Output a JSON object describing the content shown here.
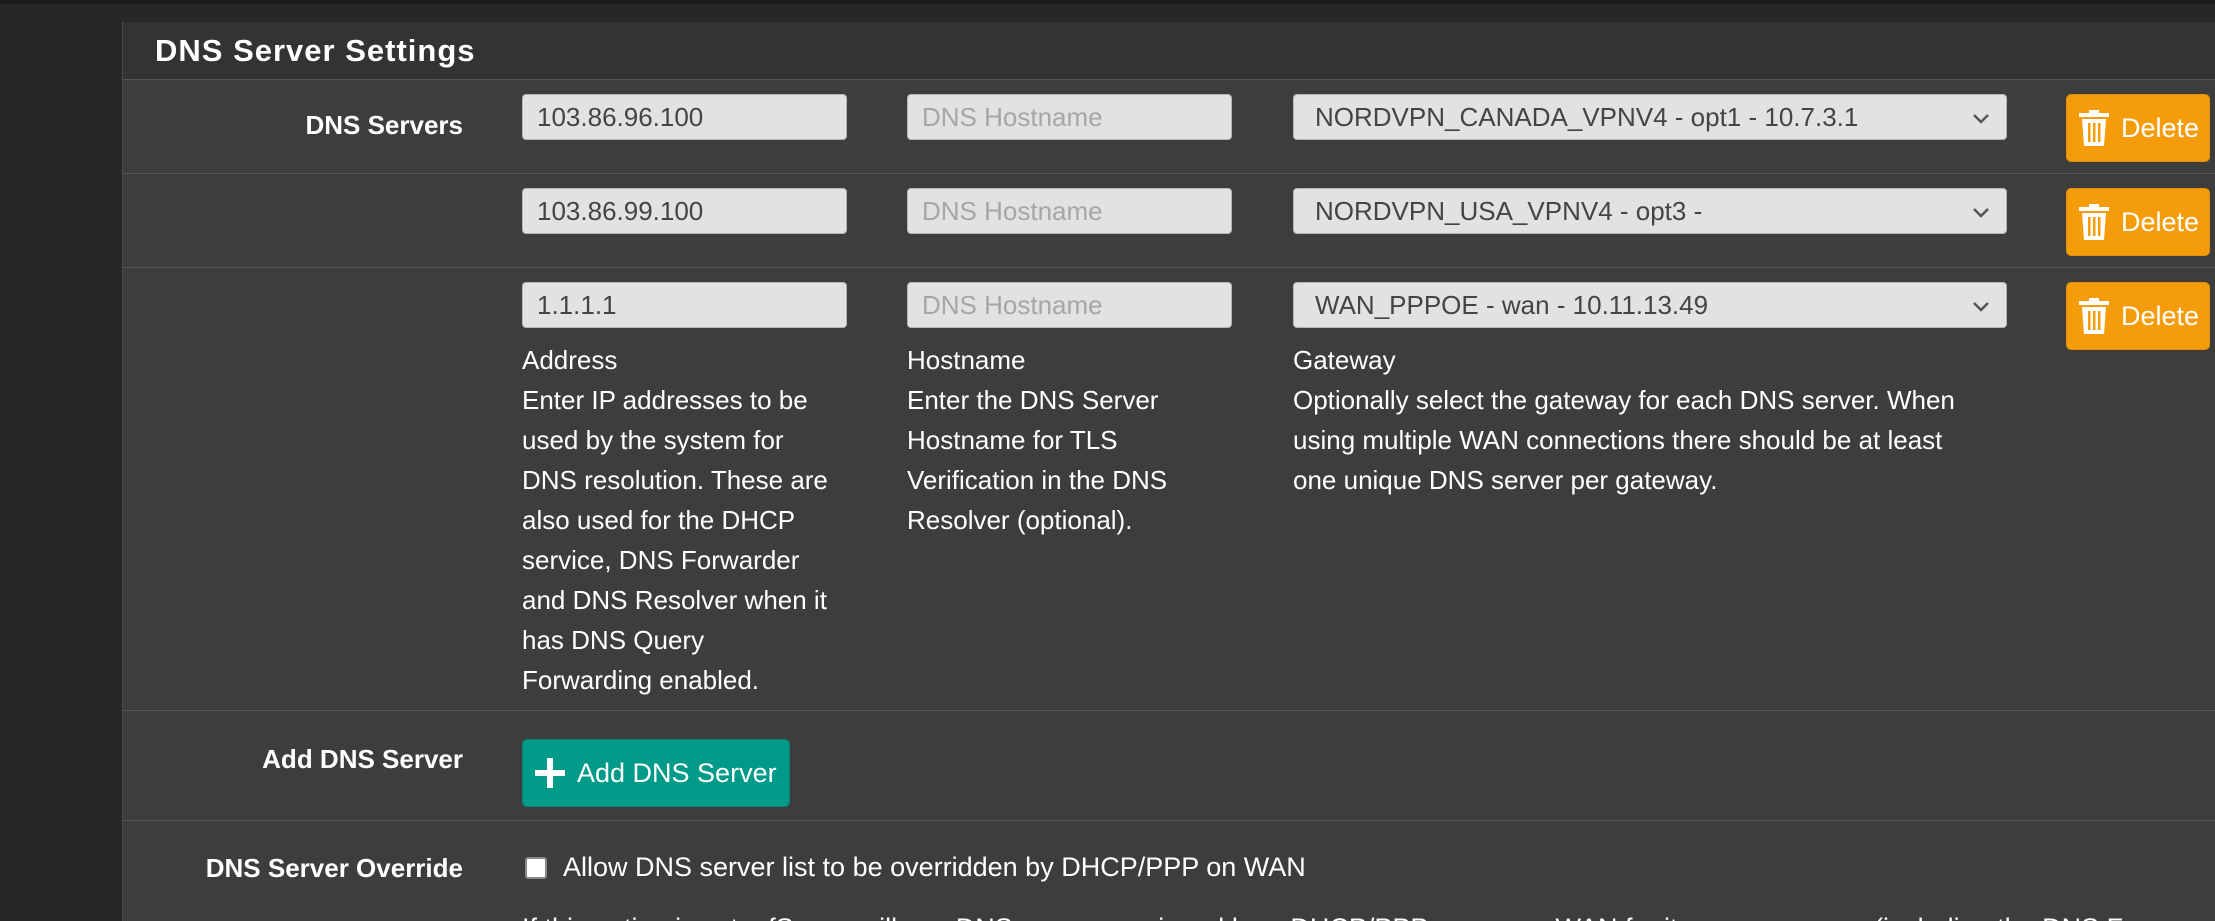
{
  "panel": {
    "title": "DNS Server Settings"
  },
  "dns_servers": {
    "label": "DNS Servers",
    "entries": [
      {
        "address": "103.86.96.100",
        "hostname_placeholder": "DNS Hostname",
        "gateway": "NORDVPN_CANADA_VPNV4 - opt1 - 10.7.3.1",
        "delete_label": "Delete"
      },
      {
        "address": "103.86.99.100",
        "hostname_placeholder": "DNS Hostname",
        "gateway": "NORDVPN_USA_VPNV4 - opt3 -",
        "delete_label": "Delete"
      },
      {
        "address": "1.1.1.1",
        "hostname_placeholder": "DNS Hostname",
        "gateway": "WAN_PPPOE - wan - 10.11.13.49",
        "delete_label": "Delete"
      }
    ],
    "help": {
      "address": {
        "title": "Address",
        "lines": [
          "Enter IP addresses to be",
          "used by the system for",
          "DNS resolution. These are",
          "also used for the DHCP",
          "service, DNS Forwarder",
          "and DNS Resolver when it",
          "has DNS Query",
          "Forwarding enabled."
        ]
      },
      "hostname": {
        "title": "Hostname",
        "lines": [
          "Enter the DNS Server",
          "Hostname for TLS",
          "Verification in the DNS",
          "Resolver (optional)."
        ]
      },
      "gateway": {
        "title": "Gateway",
        "lines": [
          "Optionally select the gateway for each DNS server. When",
          "using multiple WAN connections there should be at least",
          "one unique DNS server per gateway."
        ]
      }
    }
  },
  "add_dns": {
    "label": "Add DNS Server",
    "button_label": "Add DNS Server"
  },
  "override": {
    "label": "DNS Server Override",
    "checkbox_label": "Allow DNS server list to be overridden by DHCP/PPP on WAN",
    "checked": false,
    "help_partial": "If this option is set, pfSense will use DNS servers assigned by a DHCP/PPP server on WAN for its own purposes (including the DNS Forwa"
  },
  "colors": {
    "delete": "#f49c0a",
    "add": "#009a89",
    "panel": "#3d3d3d"
  }
}
